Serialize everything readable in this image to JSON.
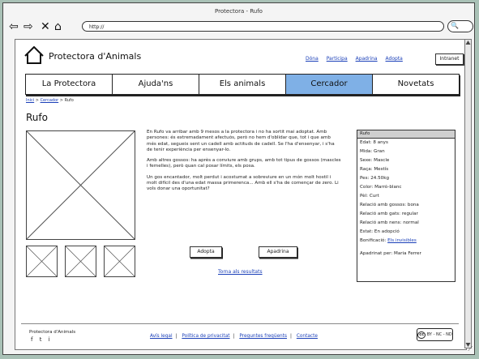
{
  "window": {
    "title": "Protectora - Rufo"
  },
  "browser": {
    "url": "http://"
  },
  "header": {
    "logo_text": "Protectora d'Animals",
    "links": [
      "Dóna",
      "Participa",
      "Apadrina",
      "Adopta"
    ],
    "intranet_label": "Intranet"
  },
  "nav": {
    "items": [
      "La Protectora",
      "Ajuda'ns",
      "Els animals",
      "Cercador",
      "Novetats"
    ],
    "active": "Cercador"
  },
  "breadcrumb": {
    "home": "Inici",
    "search": "Cercador",
    "current": "Rufo",
    "separator": ">"
  },
  "animal": {
    "name": "Rufo",
    "description": [
      "En Rufo va arribar amb 9 mesos a la protectora i no ha sortit mai adoptat. Amb persones: és extremadament afectuós, però no hem d'oblidar que, tot i que amb més edat, segueix sent un cadell amb actituds de cadell. Se l'ha d'ensenyar, i s'ha de tenir experiència per ensenyar-lo.",
      "Amb altres gossos: ha après a conviure amb grups, amb tot tipus de gossos (mascles i femelles), però quan cal posar límits, els posa.",
      "Un gos encantador, molt perdut i acostumat a sobreviure en un món molt hostil i molt difícil des d'una edat massa primerenca... Amb ell s'ha de començar de zero. Li vols donar una oportunitat?"
    ],
    "buttons": {
      "adopt": "Adopta",
      "sponsor": "Apadrina"
    },
    "back_link": "Torna als resultats"
  },
  "infobox": {
    "title": "Rufo",
    "rows": [
      "Edat: 8 anys",
      "Mida: Gran",
      "Sexe: Mascle",
      "Raça: Mestís",
      "Pes: 24.50kg",
      "Color: Marró-blanc",
      "Pèl: Curt",
      "Relació amb gossos: bona",
      "Relació amb gats: regular",
      "Relació amb nens: normal",
      "Estat: En adopció"
    ],
    "bonus_label": "Bonificació:",
    "bonus_link": "Els invisibles",
    "sponsor": "Apadrinat per: Maria Ferrer"
  },
  "footer": {
    "brand": "Protectora d'Animals",
    "social_icons": [
      "facebook-icon",
      "twitter-icon",
      "instagram-icon"
    ],
    "social_glyphs": "f t i",
    "links": [
      "Avís legal",
      "Política de privacitat",
      "Preguntes freqüents",
      "Contacte"
    ],
    "license": "BY - NC - ND",
    "license_mark": "cc"
  }
}
